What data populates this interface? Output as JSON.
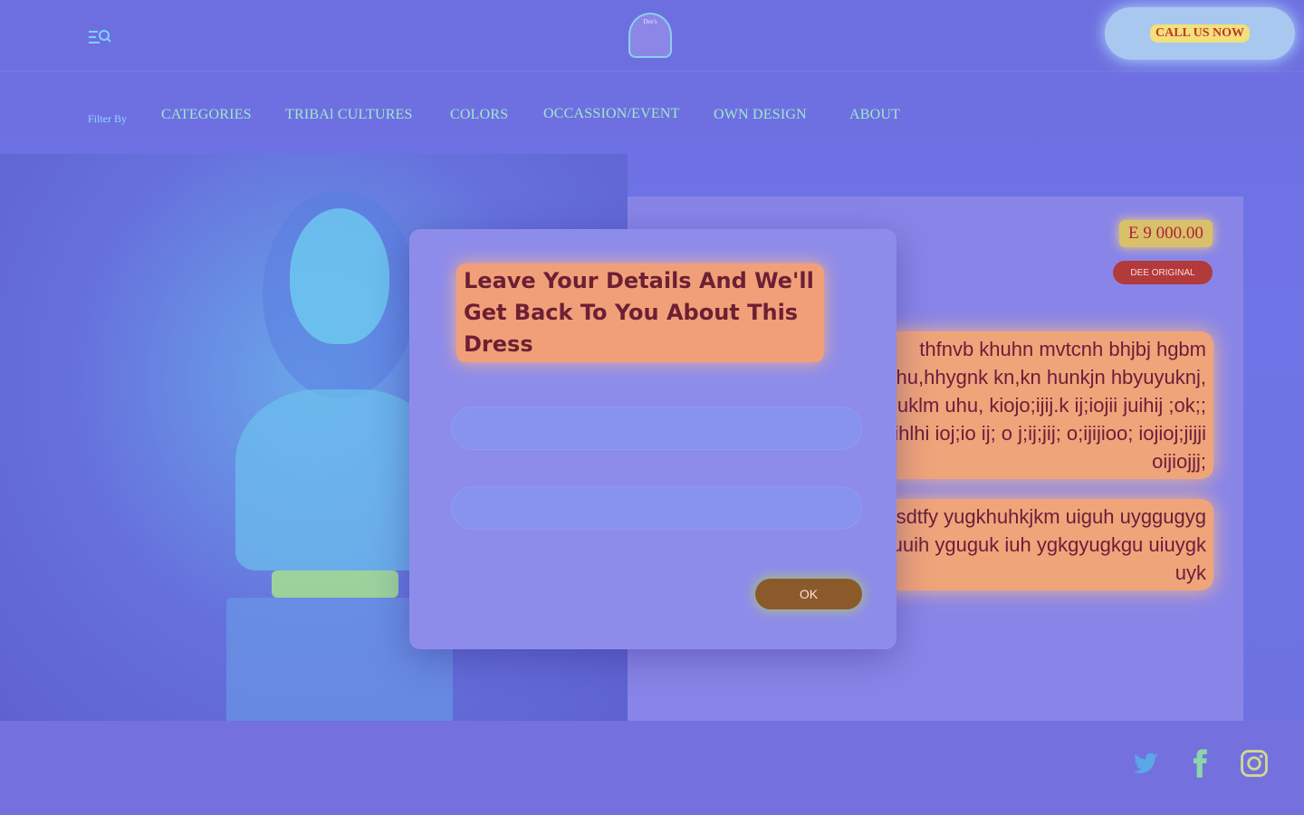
{
  "header": {
    "menu_icon": "search-menu-icon",
    "logo_text": "Dee's",
    "call_label": "CALL US NOW"
  },
  "nav": {
    "filter_label": "Filter By",
    "items": [
      {
        "label": "CATEGORIES"
      },
      {
        "label": "TRIBAl CULTURES"
      },
      {
        "label": "COLORS"
      },
      {
        "label": "OCCASSION/EVENT"
      },
      {
        "label": "OWN DESIGN"
      },
      {
        "label": "ABOUT"
      }
    ]
  },
  "product": {
    "price": "E  9 000.00",
    "badge": "DEE ORIGINAL",
    "description_1": "thfnvb khuhn mvtcnh bhjbj hgbm jhhu,hhygnk kn,kn hunkjn hbyuyuknj, oiuklm uhu, kiojo;ijij.k ij;iojii juihij ;ok;;  uihlhi  ioj;io ij; o j;ij;jij; o;ijijioo; iojioj;jijji oijiojjj;",
    "description_2": "fdsdtfy yugkhuhkjkm uiguh uyggugyg uuih yguguk iuh ygkgyugkgu uiuygk uyk"
  },
  "modal": {
    "title": "Leave Your Details And We'll Get Back To You About This Dress",
    "ok_label": "OK"
  },
  "footer": {
    "icons": [
      "twitter-icon",
      "facebook-icon",
      "instagram-icon"
    ]
  },
  "colors": {
    "accent": "#f19f78",
    "button": "#8a5a2a",
    "badge": "#b23a3a"
  }
}
